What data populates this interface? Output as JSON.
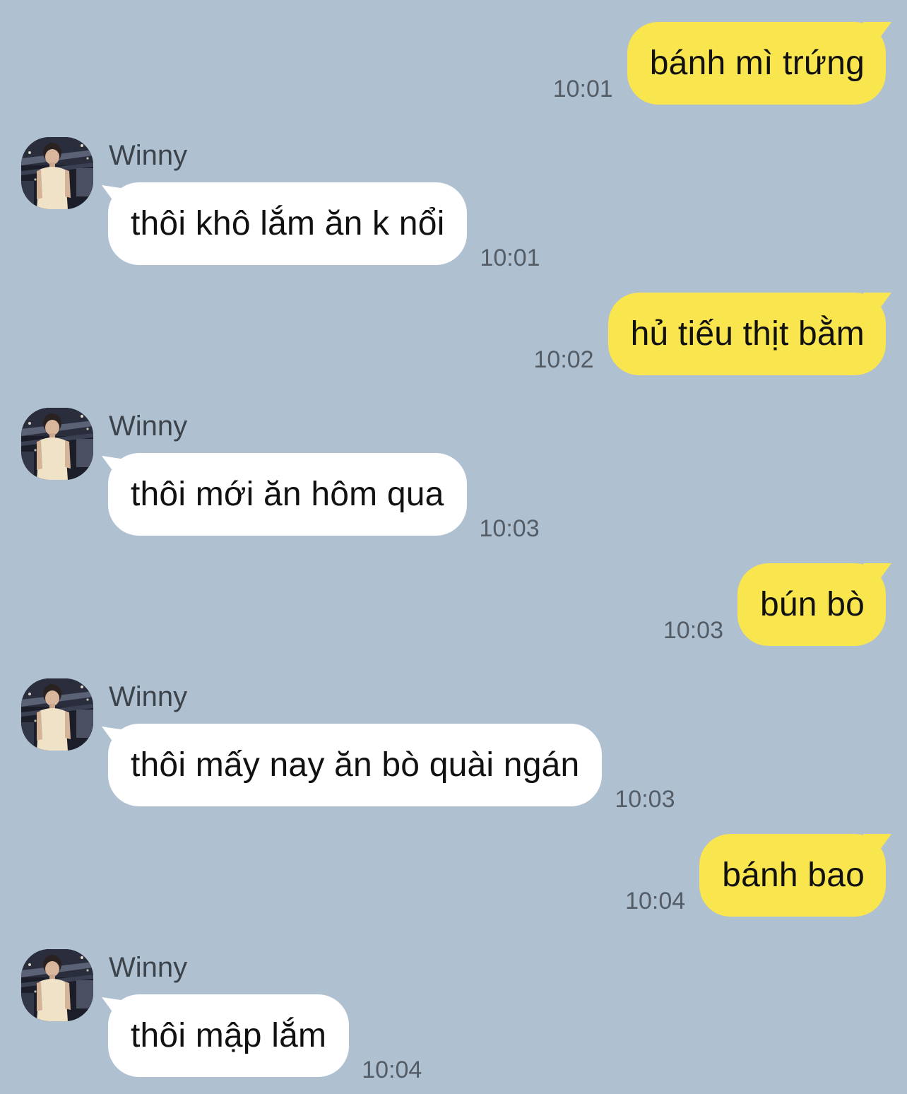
{
  "contact": {
    "name": "Winny"
  },
  "colors": {
    "background": "#afc1d1",
    "outgoing_bubble": "#f9e54e",
    "incoming_bubble": "#ffffff",
    "timestamp": "#545c66"
  },
  "messages": [
    {
      "from": "me",
      "text": "bánh mì trứng",
      "time": "10:01"
    },
    {
      "from": "Winny",
      "sender": "Winny",
      "text": "thôi khô lắm ăn k nổi",
      "time": "10:01",
      "avatar": "contact-avatar"
    },
    {
      "from": "me",
      "text": "hủ tiếu thịt bằm",
      "time": "10:02"
    },
    {
      "from": "Winny",
      "sender": "Winny",
      "text": "thôi mới ăn hôm qua",
      "time": "10:03",
      "avatar": "contact-avatar"
    },
    {
      "from": "me",
      "text": "bún bò",
      "time": "10:03"
    },
    {
      "from": "Winny",
      "sender": "Winny",
      "text": "thôi mấy nay ăn bò quài ngán",
      "time": "10:03",
      "avatar": "contact-avatar"
    },
    {
      "from": "me",
      "text": "bánh bao",
      "time": "10:04"
    },
    {
      "from": "Winny",
      "sender": "Winny",
      "text": "thôi mập lắm",
      "time": "10:04",
      "avatar": "contact-avatar"
    }
  ]
}
